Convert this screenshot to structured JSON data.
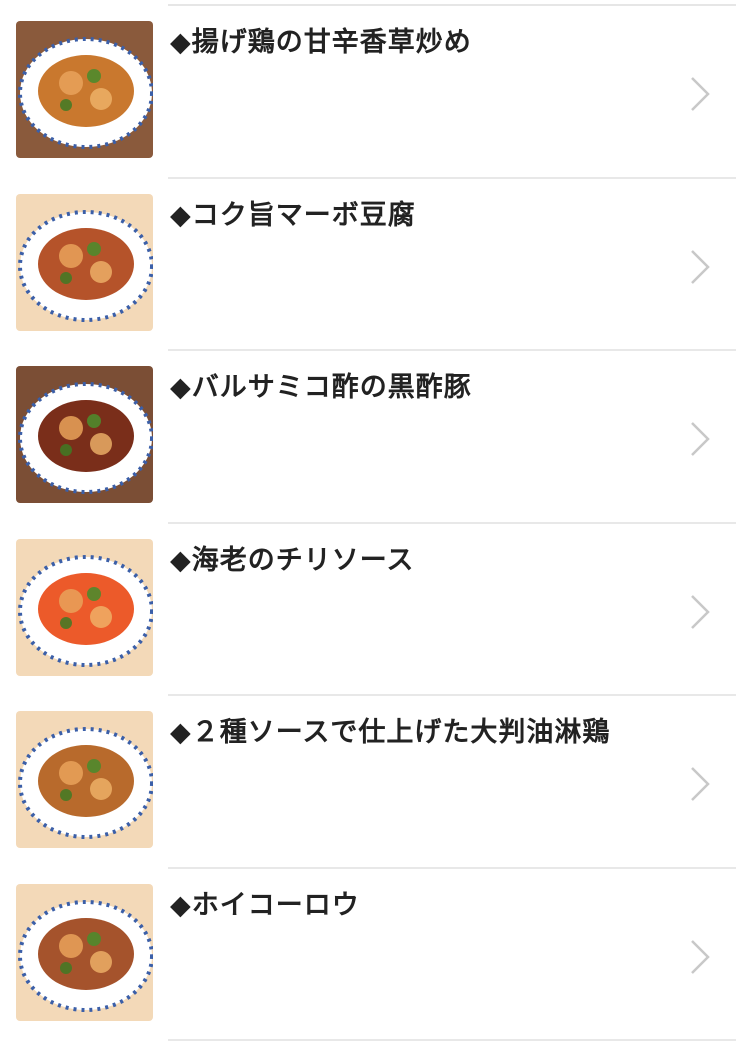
{
  "menu": {
    "items": [
      {
        "title": "◆揚げ鶏の甘辛香草炒め",
        "image": "fried-chicken-herb-stir-fry-photo",
        "bg": "#8a5a3c",
        "sauce": "#c9782e",
        "chevron_icon": "chevron-right-icon"
      },
      {
        "title": "◆コク旨マーボ豆腐",
        "image": "mapo-tofu-photo",
        "bg": "#f3d9b8",
        "sauce": "#b5532a",
        "chevron_icon": "chevron-right-icon"
      },
      {
        "title": "◆バルサミコ酢の黒酢豚",
        "image": "balsamic-black-vinegar-pork-photo",
        "bg": "#7b4e35",
        "sauce": "#7a2e1a",
        "chevron_icon": "chevron-right-icon"
      },
      {
        "title": "◆海老のチリソース",
        "image": "shrimp-chili-sauce-photo",
        "bg": "#f3d9b8",
        "sauce": "#ec5a2a",
        "chevron_icon": "chevron-right-icon"
      },
      {
        "title": "◆２種ソースで仕上げた大判油淋鶏",
        "image": "large-yurinchi-chicken-photo",
        "bg": "#f3d9b8",
        "sauce": "#b86a2c",
        "chevron_icon": "chevron-right-icon"
      },
      {
        "title": "◆ホイコーロウ",
        "image": "hoikoro-pork-cabbage-photo",
        "bg": "#f3d9b8",
        "sauce": "#a5532c",
        "chevron_icon": "chevron-right-icon"
      }
    ]
  }
}
